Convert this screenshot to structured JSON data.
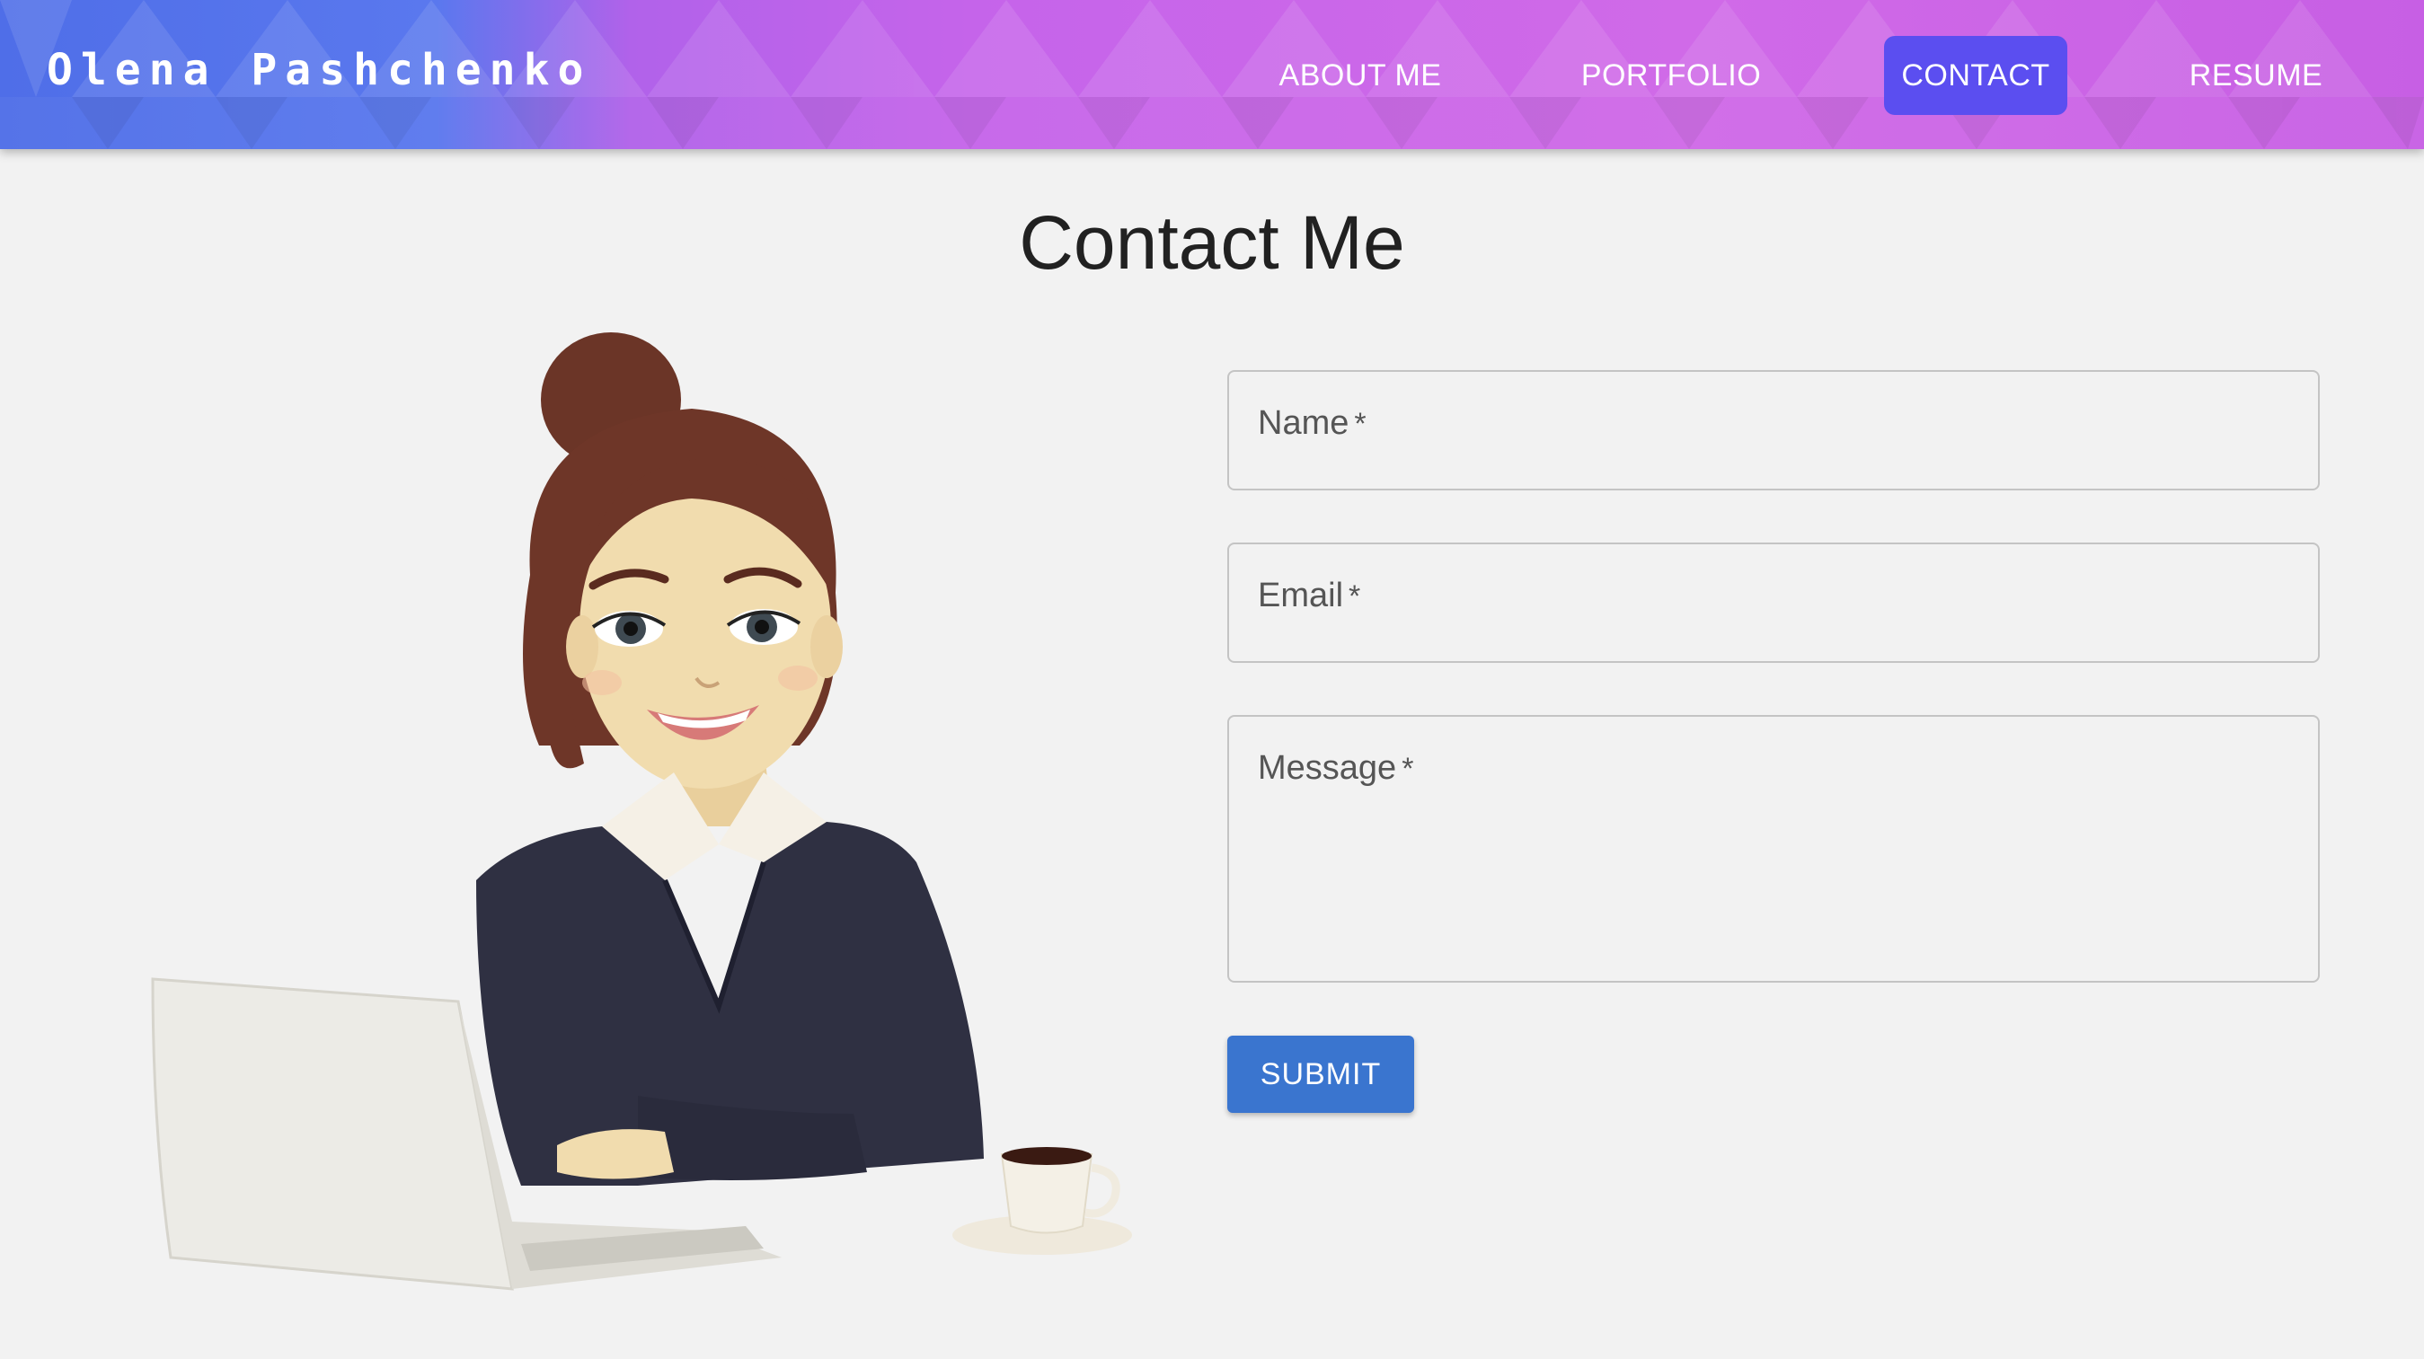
{
  "header": {
    "brand": "Olena Pashchenko",
    "nav": [
      {
        "label": "ABOUT ME",
        "active": false
      },
      {
        "label": "PORTFOLIO",
        "active": false
      },
      {
        "label": "CONTACT",
        "active": true
      },
      {
        "label": "RESUME",
        "active": false
      }
    ],
    "colors": {
      "gradient_start": "#4f6ee8",
      "gradient_end": "#d06ae8",
      "active_tab": "#5b4ef0"
    }
  },
  "main": {
    "title": "Contact Me",
    "illustration": "woman-at-laptop-illustration",
    "form": {
      "name_label": "Name",
      "email_label": "Email",
      "message_label": "Message",
      "required_mark": "*",
      "submit_label": "SUBMIT",
      "submit_color": "#3a75cf"
    }
  }
}
